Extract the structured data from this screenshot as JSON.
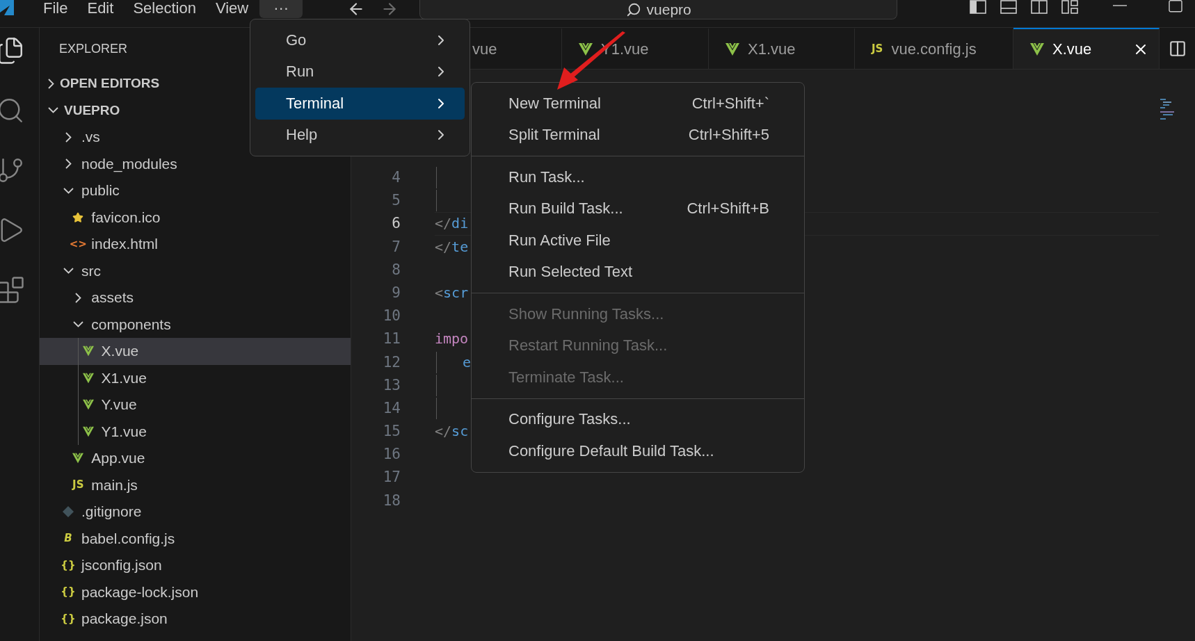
{
  "title_bar": {
    "menus": [
      {
        "label": "File",
        "selected": false
      },
      {
        "label": "Edit",
        "selected": false
      },
      {
        "label": "Selection",
        "selected": false
      },
      {
        "label": "View",
        "selected": false
      },
      {
        "label": "···",
        "selected": true
      }
    ],
    "search": {
      "value": "vuepro"
    }
  },
  "activity_bar": [
    {
      "kind": "files",
      "selected": true
    },
    {
      "kind": "search",
      "selected": false
    },
    {
      "kind": "source-control",
      "selected": false
    },
    {
      "kind": "run",
      "selected": false
    },
    {
      "kind": "extensions",
      "selected": false
    }
  ],
  "sidebar": {
    "title": "EXPLORER",
    "sections": [
      {
        "label": "OPEN EDITORS",
        "expanded": false
      },
      {
        "label": "VUEPRO",
        "expanded": true,
        "tree": [
          {
            "label": ".vs",
            "kind": "folder",
            "expanded": false,
            "selected": false
          },
          {
            "label": "node_modules",
            "kind": "folder",
            "expanded": false,
            "selected": false
          },
          {
            "label": "public",
            "kind": "folder",
            "expanded": true,
            "selected": false,
            "children": [
              {
                "label": "favicon.ico",
                "kind": "star",
                "selected": false
              },
              {
                "label": "index.html",
                "kind": "html",
                "icon_text": "<>",
                "selected": false
              }
            ]
          },
          {
            "label": "src",
            "kind": "folder",
            "expanded": true,
            "selected": false,
            "children": [
              {
                "label": "assets",
                "kind": "folder",
                "expanded": false,
                "selected": false
              },
              {
                "label": "components",
                "kind": "folder",
                "expanded": true,
                "selected": false,
                "children": [
                  {
                    "label": "X.vue",
                    "kind": "vue",
                    "selected": true
                  },
                  {
                    "label": "X1.vue",
                    "kind": "vue",
                    "selected": false
                  },
                  {
                    "label": "Y.vue",
                    "kind": "vue",
                    "selected": false
                  },
                  {
                    "label": "Y1.vue",
                    "kind": "vue",
                    "selected": false
                  }
                ]
              },
              {
                "label": "App.vue",
                "kind": "vue",
                "selected": false
              },
              {
                "label": "main.js",
                "kind": "js",
                "icon_text": "JS",
                "selected": false
              }
            ]
          },
          {
            "label": ".gitignore",
            "kind": "git",
            "selected": false
          },
          {
            "label": "babel.config.js",
            "kind": "babel",
            "icon_text": "B",
            "selected": false
          },
          {
            "label": "jsconfig.json",
            "kind": "json",
            "icon_text": "{}",
            "selected": false
          },
          {
            "label": "package-lock.json",
            "kind": "json",
            "icon_text": "{}",
            "selected": false
          },
          {
            "label": "package.json",
            "kind": "json",
            "icon_text": "{}",
            "selected": false
          }
        ]
      }
    ]
  },
  "tabs": [
    {
      "label": "vue",
      "selected": false
    },
    {
      "label": "Y1.vue",
      "kind": "vue",
      "selected": false
    },
    {
      "label": "X1.vue",
      "kind": "vue",
      "selected": false
    },
    {
      "label": "vue.config.js",
      "kind": "js",
      "icon_text": "JS",
      "selected": false
    },
    {
      "label": "X.vue",
      "kind": "vue",
      "selected": true
    }
  ],
  "editor": {
    "lines": [
      {
        "number": "4",
        "current": false,
        "guide": true
      },
      {
        "number": "5",
        "current": false,
        "guide": true
      },
      {
        "number": "6",
        "current": true,
        "guide": false,
        "tokens": [
          {
            "text": "</",
            "kind": "punct"
          },
          {
            "text": "di",
            "kind": "tag"
          }
        ]
      },
      {
        "number": "7",
        "current": false,
        "guide": false,
        "tokens": [
          {
            "text": "</",
            "kind": "punct"
          },
          {
            "text": "te",
            "kind": "tag"
          }
        ]
      },
      {
        "number": "8",
        "current": false,
        "guide": false
      },
      {
        "number": "9",
        "current": false,
        "guide": false,
        "tokens": [
          {
            "text": "<",
            "kind": "punct"
          },
          {
            "text": "scr",
            "kind": "tag"
          }
        ]
      },
      {
        "number": "10",
        "current": false,
        "guide": false
      },
      {
        "number": "11",
        "current": false,
        "guide": false,
        "tokens": [
          {
            "text": "impo",
            "kind": "keyword"
          }
        ]
      },
      {
        "number": "12",
        "current": false,
        "guide": true,
        "indented": true,
        "tokens": [
          {
            "text": "e",
            "kind": "tag"
          }
        ]
      },
      {
        "number": "13",
        "current": false,
        "guide": true
      },
      {
        "number": "14",
        "current": false,
        "guide": true
      },
      {
        "number": "15",
        "current": false,
        "guide": false,
        "tokens": [
          {
            "text": "</",
            "kind": "punct"
          },
          {
            "text": "sc",
            "kind": "tag"
          }
        ]
      },
      {
        "number": "16",
        "current": false,
        "guide": false
      },
      {
        "number": "17",
        "current": false,
        "guide": false
      },
      {
        "number": "18",
        "current": false,
        "guide": false
      }
    ]
  },
  "menu": {
    "items": [
      {
        "label": "Go",
        "selected": false
      },
      {
        "label": "Run",
        "selected": false
      },
      {
        "label": "Terminal",
        "selected": true
      },
      {
        "label": "Help",
        "selected": false
      }
    ]
  },
  "submenu": {
    "groups": [
      [
        {
          "label": "New Terminal",
          "shortcut": "Ctrl+Shift+`",
          "disabled": false
        },
        {
          "label": "Split Terminal",
          "shortcut": "Ctrl+Shift+5",
          "disabled": false
        }
      ],
      [
        {
          "label": "Run Task...",
          "disabled": false
        },
        {
          "label": "Run Build Task...",
          "shortcut": "Ctrl+Shift+B",
          "disabled": false
        },
        {
          "label": "Run Active File",
          "disabled": false
        },
        {
          "label": "Run Selected Text",
          "disabled": false
        }
      ],
      [
        {
          "label": "Show Running Tasks...",
          "disabled": true
        },
        {
          "label": "Restart Running Task...",
          "disabled": true
        },
        {
          "label": "Terminate Task...",
          "disabled": true
        }
      ],
      [
        {
          "label": "Configure Tasks...",
          "disabled": false
        },
        {
          "label": "Configure Default Build Task...",
          "disabled": false
        }
      ]
    ]
  }
}
